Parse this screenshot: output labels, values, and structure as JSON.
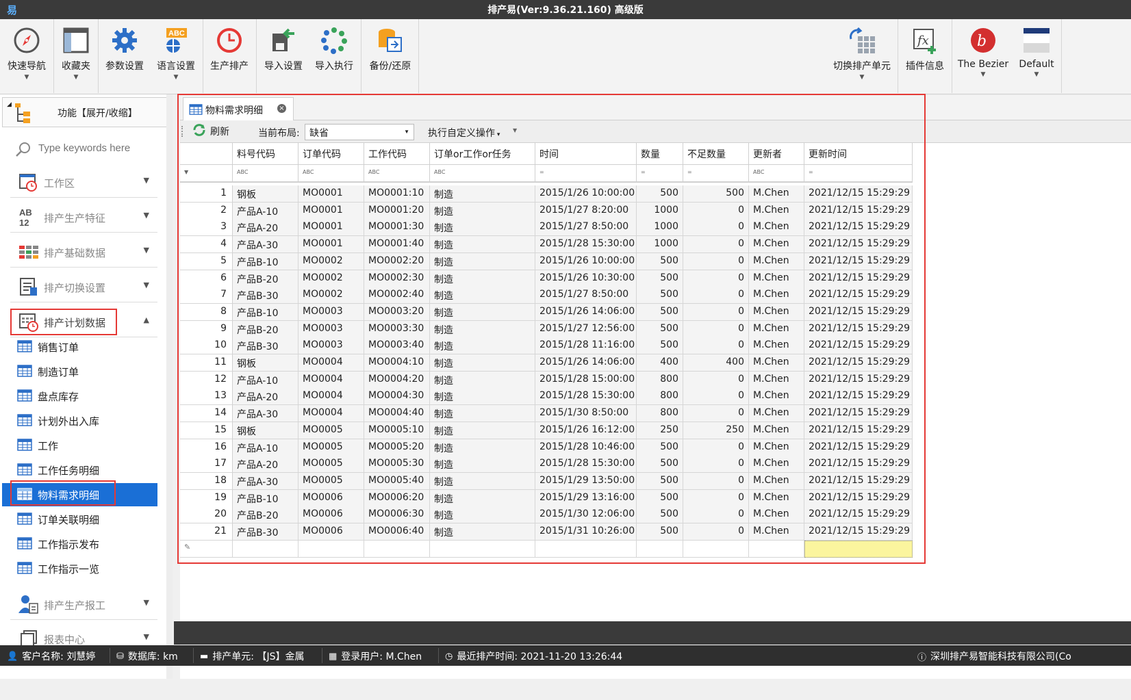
{
  "window": {
    "title": "排产易(Ver:9.36.21.160) 高级版"
  },
  "ribbon": {
    "quick_nav": "快速导航",
    "favorites": "收藏夹",
    "params": "参数设置",
    "language": "语言设置",
    "schedule": "生产排产",
    "import_settings": "导入设置",
    "import_exec": "导入执行",
    "backup": "备份/还原",
    "switch_unit": "切换排产单元",
    "plugin_info": "插件信息",
    "theme_bezier": "The Bezier",
    "theme_default": "Default",
    "lang_icon_text": "ABC"
  },
  "sidebar": {
    "header": "功能【展开/收缩】",
    "search_placeholder": "Type keywords here",
    "sections": [
      {
        "label": "工作区"
      },
      {
        "label": "排产生产特征"
      },
      {
        "label": "排产基础数据"
      },
      {
        "label": "排产切换设置"
      },
      {
        "label": "排产计划数据"
      },
      {
        "label": "排产生产报工"
      },
      {
        "label": "报表中心"
      }
    ],
    "items": [
      {
        "label": "销售订单"
      },
      {
        "label": "制造订单"
      },
      {
        "label": "盘点库存"
      },
      {
        "label": "计划外出入库"
      },
      {
        "label": "工作"
      },
      {
        "label": "工作任务明细"
      },
      {
        "label": "物料需求明细"
      },
      {
        "label": "订单关联明细"
      },
      {
        "label": "工作指示发布"
      },
      {
        "label": "工作指示一览"
      }
    ]
  },
  "tab": {
    "label": "物料需求明细"
  },
  "toolbar": {
    "refresh": "刷新",
    "layout_label": "当前布局:",
    "layout_value": "缺省",
    "custom_action": "执行自定义操作"
  },
  "table": {
    "columns": [
      "料号代码",
      "订单代码",
      "工作代码",
      "订单or工作or任务",
      "时间",
      "数量",
      "不足数量",
      "更新者",
      "更新时间"
    ],
    "filter_icons": [
      "ABC",
      "ABC",
      "ABC",
      "ABC",
      "=",
      "=",
      "=",
      "ABC",
      "="
    ],
    "rows": [
      [
        "1",
        "钢板",
        "MO0001",
        "MO0001:10",
        "制造",
        "2015/1/26 10:00:00",
        "500",
        "500",
        "M.Chen",
        "2021/12/15 15:29:29"
      ],
      [
        "2",
        "产品A-10",
        "MO0001",
        "MO0001:20",
        "制造",
        "2015/1/27 8:20:00",
        "1000",
        "0",
        "M.Chen",
        "2021/12/15 15:29:29"
      ],
      [
        "3",
        "产品A-20",
        "MO0001",
        "MO0001:30",
        "制造",
        "2015/1/27 8:50:00",
        "1000",
        "0",
        "M.Chen",
        "2021/12/15 15:29:29"
      ],
      [
        "4",
        "产品A-30",
        "MO0001",
        "MO0001:40",
        "制造",
        "2015/1/28 15:30:00",
        "1000",
        "0",
        "M.Chen",
        "2021/12/15 15:29:29"
      ],
      [
        "5",
        "产品B-10",
        "MO0002",
        "MO0002:20",
        "制造",
        "2015/1/26 10:00:00",
        "500",
        "0",
        "M.Chen",
        "2021/12/15 15:29:29"
      ],
      [
        "6",
        "产品B-20",
        "MO0002",
        "MO0002:30",
        "制造",
        "2015/1/26 10:30:00",
        "500",
        "0",
        "M.Chen",
        "2021/12/15 15:29:29"
      ],
      [
        "7",
        "产品B-30",
        "MO0002",
        "MO0002:40",
        "制造",
        "2015/1/27 8:50:00",
        "500",
        "0",
        "M.Chen",
        "2021/12/15 15:29:29"
      ],
      [
        "8",
        "产品B-10",
        "MO0003",
        "MO0003:20",
        "制造",
        "2015/1/26 14:06:00",
        "500",
        "0",
        "M.Chen",
        "2021/12/15 15:29:29"
      ],
      [
        "9",
        "产品B-20",
        "MO0003",
        "MO0003:30",
        "制造",
        "2015/1/27 12:56:00",
        "500",
        "0",
        "M.Chen",
        "2021/12/15 15:29:29"
      ],
      [
        "10",
        "产品B-30",
        "MO0003",
        "MO0003:40",
        "制造",
        "2015/1/28 11:16:00",
        "500",
        "0",
        "M.Chen",
        "2021/12/15 15:29:29"
      ],
      [
        "11",
        "钢板",
        "MO0004",
        "MO0004:10",
        "制造",
        "2015/1/26 14:06:00",
        "400",
        "400",
        "M.Chen",
        "2021/12/15 15:29:29"
      ],
      [
        "12",
        "产品A-10",
        "MO0004",
        "MO0004:20",
        "制造",
        "2015/1/28 15:00:00",
        "800",
        "0",
        "M.Chen",
        "2021/12/15 15:29:29"
      ],
      [
        "13",
        "产品A-20",
        "MO0004",
        "MO0004:30",
        "制造",
        "2015/1/28 15:30:00",
        "800",
        "0",
        "M.Chen",
        "2021/12/15 15:29:29"
      ],
      [
        "14",
        "产品A-30",
        "MO0004",
        "MO0004:40",
        "制造",
        "2015/1/30 8:50:00",
        "800",
        "0",
        "M.Chen",
        "2021/12/15 15:29:29"
      ],
      [
        "15",
        "钢板",
        "MO0005",
        "MO0005:10",
        "制造",
        "2015/1/26 16:12:00",
        "250",
        "250",
        "M.Chen",
        "2021/12/15 15:29:29"
      ],
      [
        "16",
        "产品A-10",
        "MO0005",
        "MO0005:20",
        "制造",
        "2015/1/28 10:46:00",
        "500",
        "0",
        "M.Chen",
        "2021/12/15 15:29:29"
      ],
      [
        "17",
        "产品A-20",
        "MO0005",
        "MO0005:30",
        "制造",
        "2015/1/28 15:30:00",
        "500",
        "0",
        "M.Chen",
        "2021/12/15 15:29:29"
      ],
      [
        "18",
        "产品A-30",
        "MO0005",
        "MO0005:40",
        "制造",
        "2015/1/29 13:50:00",
        "500",
        "0",
        "M.Chen",
        "2021/12/15 15:29:29"
      ],
      [
        "19",
        "产品B-10",
        "MO0006",
        "MO0006:20",
        "制造",
        "2015/1/29 13:16:00",
        "500",
        "0",
        "M.Chen",
        "2021/12/15 15:29:29"
      ],
      [
        "20",
        "产品B-20",
        "MO0006",
        "MO0006:30",
        "制造",
        "2015/1/30 12:06:00",
        "500",
        "0",
        "M.Chen",
        "2021/12/15 15:29:29"
      ],
      [
        "21",
        "产品B-30",
        "MO0006",
        "MO0006:40",
        "制造",
        "2015/1/31 10:26:00",
        "500",
        "0",
        "M.Chen",
        "2021/12/15 15:29:29"
      ]
    ]
  },
  "status": {
    "customer": "客户名称:  刘慧婷",
    "database": "数据库:  km",
    "unit": "排产单元:  【JS】金属",
    "user": "登录用户:  M.Chen",
    "last_schedule": "最近排产时间:  2021-11-20 13:26:44",
    "company": "深圳排产易智能科技有限公司(Co"
  },
  "colors": {
    "highlight_red": "#e53935",
    "active_blue": "#1a6fd6",
    "new_row_yellow": "#fbf59e"
  }
}
